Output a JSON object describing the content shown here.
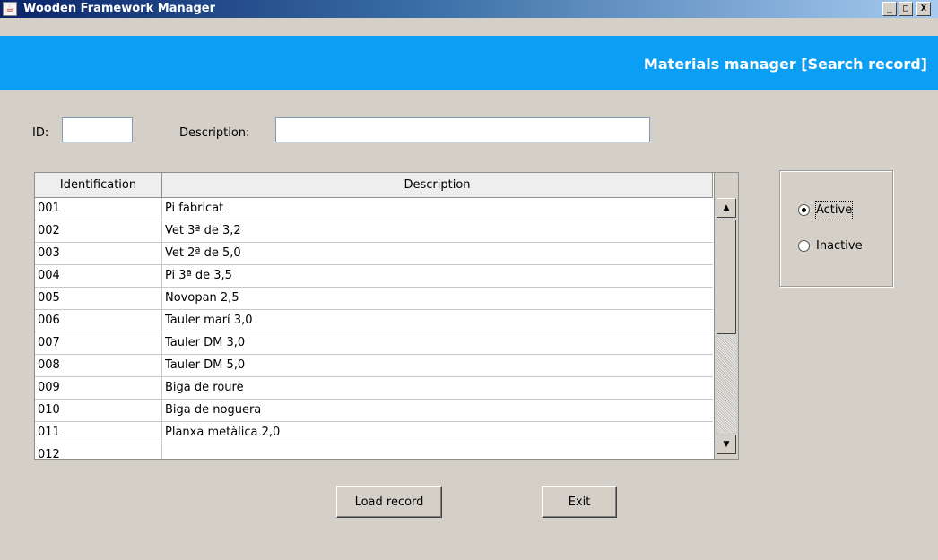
{
  "window": {
    "title": "Wooden Framework Manager",
    "controls": {
      "minimize": "_",
      "maximize": "□",
      "close": "X"
    }
  },
  "header": {
    "title": "Materials manager [Search record]"
  },
  "filters": {
    "id_label": "ID:",
    "id_value": "",
    "description_label": "Description:",
    "description_value": ""
  },
  "table": {
    "columns": [
      "Identification",
      "Description"
    ],
    "rows": [
      [
        "001",
        "Pi fabricat"
      ],
      [
        "002",
        "Vet 3ª de 3,2"
      ],
      [
        "003",
        "Vet 2ª de 5,0"
      ],
      [
        "004",
        "Pi 3ª de 3,5"
      ],
      [
        "005",
        "Novopan 2,5"
      ],
      [
        "006",
        "Tauler marí 3,0"
      ],
      [
        "007",
        "Tauler DM 3,0"
      ],
      [
        "008",
        "Tauler DM 5,0"
      ],
      [
        "009",
        "Biga de roure"
      ],
      [
        "010",
        "Biga de noguera"
      ],
      [
        "011",
        "Planxa metàlica 2,0"
      ],
      [
        "012",
        ""
      ]
    ]
  },
  "status_filter": {
    "options": [
      {
        "label": "Active",
        "checked": true
      },
      {
        "label": "Inactive",
        "checked": false
      }
    ]
  },
  "actions": {
    "load_label": "Load record",
    "exit_label": "Exit"
  },
  "colors": {
    "banner": "#0b9ef5",
    "window_bg": "#d4d0c8",
    "titlebar_start": "#0a246a"
  }
}
